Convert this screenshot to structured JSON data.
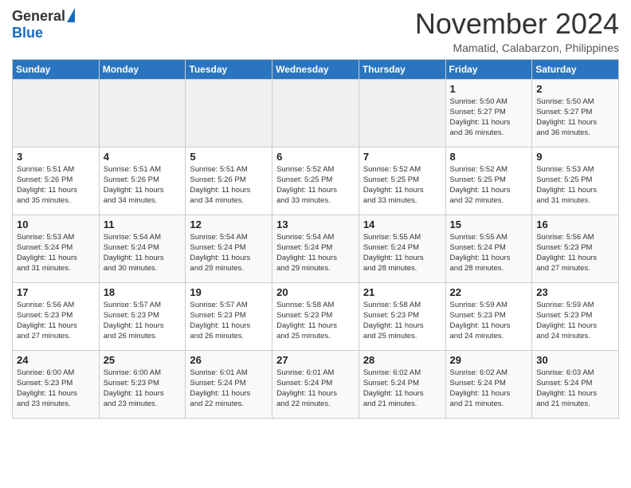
{
  "header": {
    "logo_general": "General",
    "logo_blue": "Blue",
    "month_title": "November 2024",
    "location": "Mamatid, Calabarzon, Philippines"
  },
  "weekdays": [
    "Sunday",
    "Monday",
    "Tuesday",
    "Wednesday",
    "Thursday",
    "Friday",
    "Saturday"
  ],
  "weeks": [
    [
      {
        "day": "",
        "empty": true
      },
      {
        "day": "",
        "empty": true
      },
      {
        "day": "",
        "empty": true
      },
      {
        "day": "",
        "empty": true
      },
      {
        "day": "",
        "empty": true
      },
      {
        "day": "1",
        "sunrise": "5:50 AM",
        "sunset": "5:27 PM",
        "daylight": "11 hours and 36 minutes"
      },
      {
        "day": "2",
        "sunrise": "5:50 AM",
        "sunset": "5:27 PM",
        "daylight": "11 hours and 36 minutes"
      }
    ],
    [
      {
        "day": "3",
        "sunrise": "5:51 AM",
        "sunset": "5:26 PM",
        "daylight": "11 hours and 35 minutes"
      },
      {
        "day": "4",
        "sunrise": "5:51 AM",
        "sunset": "5:26 PM",
        "daylight": "11 hours and 34 minutes"
      },
      {
        "day": "5",
        "sunrise": "5:51 AM",
        "sunset": "5:26 PM",
        "daylight": "11 hours and 34 minutes"
      },
      {
        "day": "6",
        "sunrise": "5:52 AM",
        "sunset": "5:25 PM",
        "daylight": "11 hours and 33 minutes"
      },
      {
        "day": "7",
        "sunrise": "5:52 AM",
        "sunset": "5:25 PM",
        "daylight": "11 hours and 33 minutes"
      },
      {
        "day": "8",
        "sunrise": "5:52 AM",
        "sunset": "5:25 PM",
        "daylight": "11 hours and 32 minutes"
      },
      {
        "day": "9",
        "sunrise": "5:53 AM",
        "sunset": "5:25 PM",
        "daylight": "11 hours and 31 minutes"
      }
    ],
    [
      {
        "day": "10",
        "sunrise": "5:53 AM",
        "sunset": "5:24 PM",
        "daylight": "11 hours and 31 minutes"
      },
      {
        "day": "11",
        "sunrise": "5:54 AM",
        "sunset": "5:24 PM",
        "daylight": "11 hours and 30 minutes"
      },
      {
        "day": "12",
        "sunrise": "5:54 AM",
        "sunset": "5:24 PM",
        "daylight": "11 hours and 29 minutes"
      },
      {
        "day": "13",
        "sunrise": "5:54 AM",
        "sunset": "5:24 PM",
        "daylight": "11 hours and 29 minutes"
      },
      {
        "day": "14",
        "sunrise": "5:55 AM",
        "sunset": "5:24 PM",
        "daylight": "11 hours and 28 minutes"
      },
      {
        "day": "15",
        "sunrise": "5:55 AM",
        "sunset": "5:24 PM",
        "daylight": "11 hours and 28 minutes"
      },
      {
        "day": "16",
        "sunrise": "5:56 AM",
        "sunset": "5:23 PM",
        "daylight": "11 hours and 27 minutes"
      }
    ],
    [
      {
        "day": "17",
        "sunrise": "5:56 AM",
        "sunset": "5:23 PM",
        "daylight": "11 hours and 27 minutes"
      },
      {
        "day": "18",
        "sunrise": "5:57 AM",
        "sunset": "5:23 PM",
        "daylight": "11 hours and 26 minutes"
      },
      {
        "day": "19",
        "sunrise": "5:57 AM",
        "sunset": "5:23 PM",
        "daylight": "11 hours and 26 minutes"
      },
      {
        "day": "20",
        "sunrise": "5:58 AM",
        "sunset": "5:23 PM",
        "daylight": "11 hours and 25 minutes"
      },
      {
        "day": "21",
        "sunrise": "5:58 AM",
        "sunset": "5:23 PM",
        "daylight": "11 hours and 25 minutes"
      },
      {
        "day": "22",
        "sunrise": "5:59 AM",
        "sunset": "5:23 PM",
        "daylight": "11 hours and 24 minutes"
      },
      {
        "day": "23",
        "sunrise": "5:59 AM",
        "sunset": "5:23 PM",
        "daylight": "11 hours and 24 minutes"
      }
    ],
    [
      {
        "day": "24",
        "sunrise": "6:00 AM",
        "sunset": "5:23 PM",
        "daylight": "11 hours and 23 minutes"
      },
      {
        "day": "25",
        "sunrise": "6:00 AM",
        "sunset": "5:23 PM",
        "daylight": "11 hours and 23 minutes"
      },
      {
        "day": "26",
        "sunrise": "6:01 AM",
        "sunset": "5:24 PM",
        "daylight": "11 hours and 22 minutes"
      },
      {
        "day": "27",
        "sunrise": "6:01 AM",
        "sunset": "5:24 PM",
        "daylight": "11 hours and 22 minutes"
      },
      {
        "day": "28",
        "sunrise": "6:02 AM",
        "sunset": "5:24 PM",
        "daylight": "11 hours and 21 minutes"
      },
      {
        "day": "29",
        "sunrise": "6:02 AM",
        "sunset": "5:24 PM",
        "daylight": "11 hours and 21 minutes"
      },
      {
        "day": "30",
        "sunrise": "6:03 AM",
        "sunset": "5:24 PM",
        "daylight": "11 hours and 21 minutes"
      }
    ]
  ],
  "labels": {
    "sunrise": "Sunrise:",
    "sunset": "Sunset:",
    "daylight": "Daylight:"
  }
}
